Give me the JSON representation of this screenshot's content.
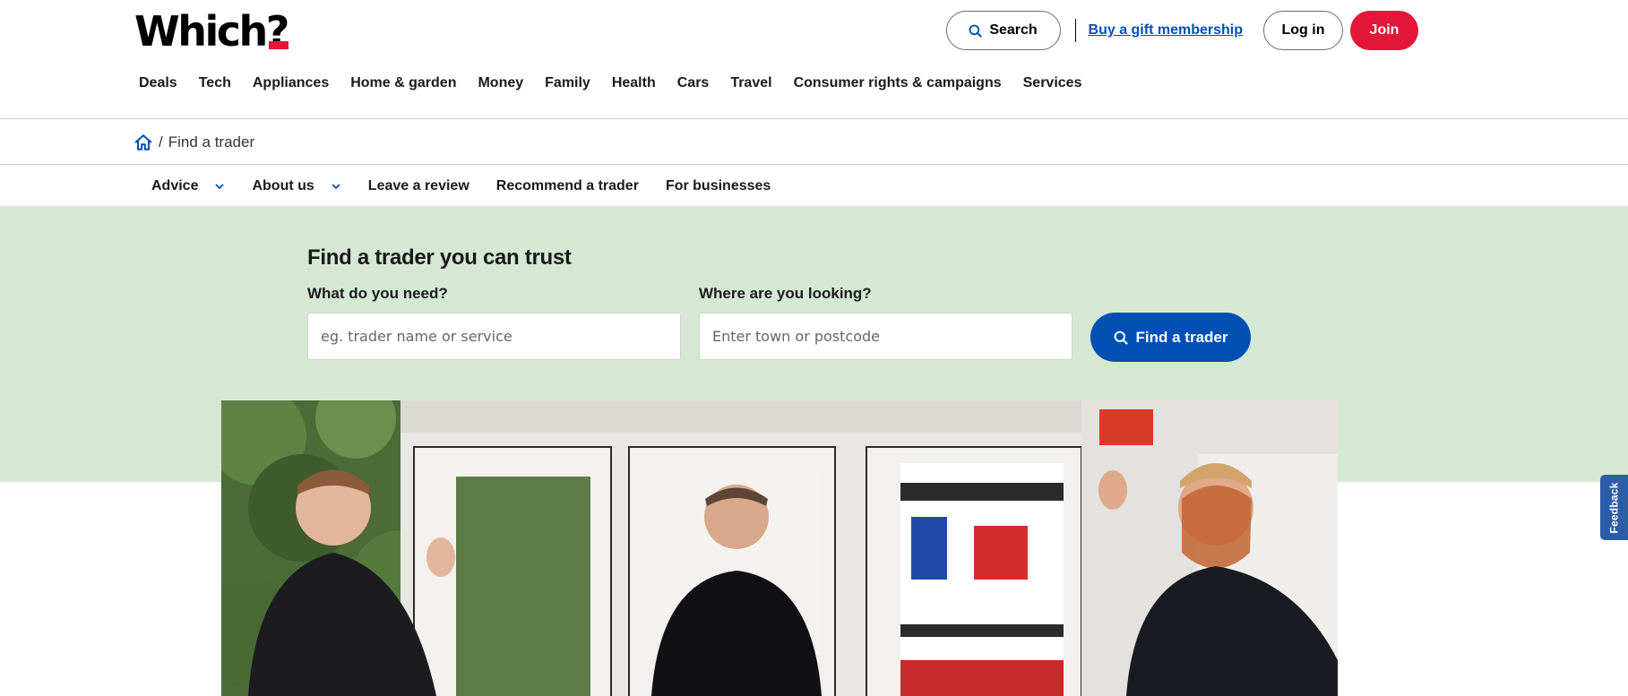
{
  "header": {
    "logo": {
      "text": "Which",
      "mark": "?"
    },
    "search_label": "Search",
    "gift_link": "Buy a gift membership",
    "login_label": "Log in",
    "join_label": "Join",
    "nav": [
      "Deals",
      "Tech",
      "Appliances",
      "Home & garden",
      "Money",
      "Family",
      "Health",
      "Cars",
      "Travel",
      "Consumer rights & campaigns",
      "Services"
    ]
  },
  "breadcrumb": {
    "separator": "/",
    "current": "Find a trader"
  },
  "subnav": {
    "advice": "Advice",
    "about": "About us",
    "review": "Leave a review",
    "recommend": "Recommend a trader",
    "business": "For businesses"
  },
  "hero": {
    "title": "Find a trader you can trust",
    "need_label": "What do you need?",
    "need_placeholder": "eg. trader name or service",
    "where_label": "Where are you looking?",
    "where_placeholder": "Enter town or postcode",
    "button_label": "Find a trader"
  },
  "feedback": {
    "label": "Feedback"
  },
  "icons": {
    "search": "search-icon",
    "home": "home-icon",
    "chevron": "chevron-down-icon"
  },
  "colors": {
    "brand_red": "#e4163a",
    "link_blue": "#0050b4",
    "hero_green": "#d4e8d3",
    "feedback_blue": "#2c5ea8"
  }
}
